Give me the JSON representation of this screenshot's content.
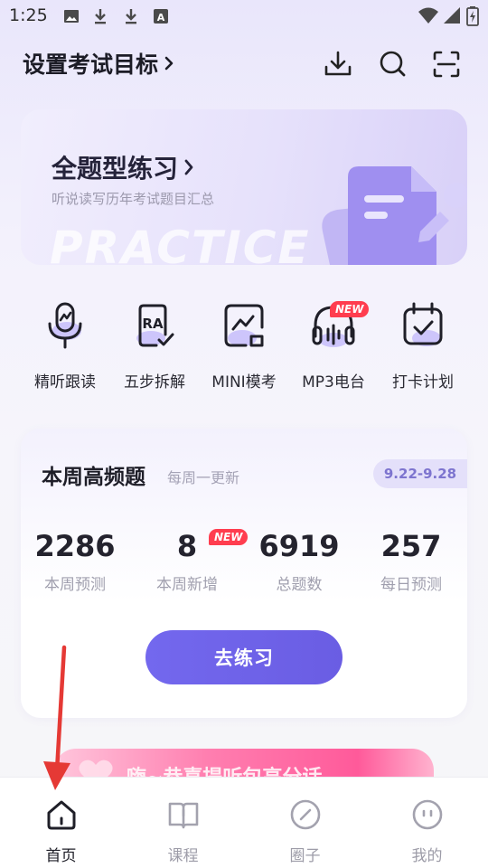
{
  "status_bar": {
    "time": "1:25",
    "icons": [
      "image-icon",
      "download-icon",
      "download-icon",
      "font-icon"
    ],
    "right_icons": [
      "wifi-icon",
      "signal-icon",
      "battery-icon"
    ]
  },
  "header": {
    "title": "设置考试目标",
    "title_chevron": "›",
    "actions": [
      "download-icon",
      "search-icon",
      "scan-icon"
    ]
  },
  "banner": {
    "title": "全题型练习",
    "subtitle": "听说读写历年考试题目汇总",
    "watermark": "PRACTICE"
  },
  "tools": [
    {
      "label": "精听跟读",
      "icon": "microphone-icon"
    },
    {
      "label": "五步拆解",
      "icon": "ra-check-icon",
      "icon_text": "RA"
    },
    {
      "label": "MINI模考",
      "icon": "mini-exam-icon"
    },
    {
      "label": "MP3电台",
      "icon": "headphones-icon",
      "badge": "NEW"
    },
    {
      "label": "打卡计划",
      "icon": "calendar-check-icon"
    }
  ],
  "weekly": {
    "title": "本周高频题",
    "subtitle": "每周一更新",
    "date_range": "9.22-9.28",
    "stats": [
      {
        "value": "2286",
        "label": "本周预测"
      },
      {
        "value": "8",
        "label": "本周新增",
        "badge": "NEW"
      },
      {
        "value": "6919",
        "label": "总题数"
      },
      {
        "value": "257",
        "label": "每日预测"
      }
    ],
    "button_label": "去练习"
  },
  "promo": {
    "text": "嗨~恭喜提听包高分话"
  },
  "bottom_nav": {
    "items": [
      {
        "label": "首页",
        "icon": "home-icon",
        "active": true
      },
      {
        "label": "课程",
        "icon": "book-icon",
        "active": false
      },
      {
        "label": "圈子",
        "icon": "circle-slash-icon",
        "active": false
      },
      {
        "label": "我的",
        "icon": "face-icon",
        "active": false
      }
    ]
  },
  "colors": {
    "accent": "#6c60e8",
    "new_badge": "#ff3d4f",
    "annotation_arrow": "#e53935"
  }
}
